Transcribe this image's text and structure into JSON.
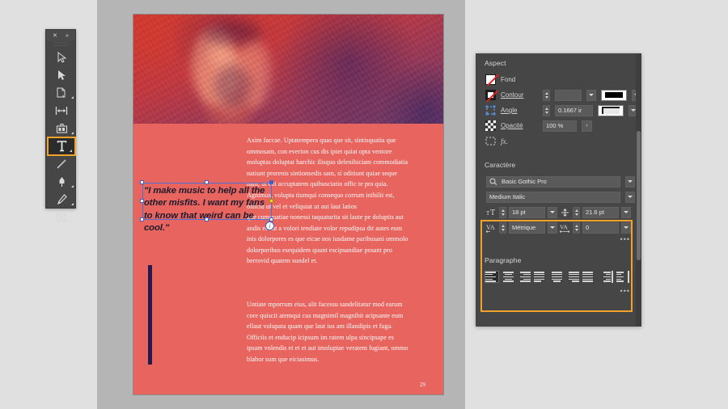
{
  "app": {
    "accent_orange": "#f0a32a",
    "panel_bg": "#464646",
    "page_bg": "#e8645e"
  },
  "toolbar": {
    "close_icon_label": "✕",
    "expand_icon_label": "»",
    "tools": [
      {
        "name": "selection-tool",
        "label": "Sélection",
        "active": false
      },
      {
        "name": "direct-selection-tool",
        "label": "Sélection directe",
        "active": false
      },
      {
        "name": "page-tool",
        "label": "Page",
        "active": false
      },
      {
        "name": "gap-tool",
        "label": "Espacement",
        "active": false
      },
      {
        "name": "content-collector-tool",
        "label": "Collecteur de contenu",
        "active": false
      },
      {
        "name": "type-tool",
        "label": "Texte",
        "active": true
      },
      {
        "name": "line-tool",
        "label": "Trait",
        "active": false
      },
      {
        "name": "pen-tool",
        "label": "Plume",
        "active": false
      },
      {
        "name": "pencil-tool",
        "label": "Crayon",
        "active": false
      },
      {
        "name": "frame-tool",
        "label": "Bloc rectangulaire",
        "active": false
      }
    ]
  },
  "document": {
    "page_number": "29",
    "paragraphs": [
      "Axim faccae. Uptatempera quas que sit, sintisquatia que ommosam, con everion cus dis ipiet quiat opta ventore moluptas doluptat harchic ilisquo delenihiciam commodiatia natiunt prorenis sintionsedis sam, si oditiunt quiae seque nam, ut eni accuptatem quibusciatio offic te pra quia. Agnimus, volupta tiumqui consequo corrum inihilit est, officid ut vel et veliquiat ut aut laut latios",
      "que cumquatiae nonessi taquaturita sit laute pe doluptis aut andis et aut a volori tendiate volor repudipsa dit autes eum inis dolorpores es que eicae nos iusdame paribusani ommolo dolorporibus esequidem quunt escipsandiae posant pro berrovid quatem sundel et.",
      "Untiate mporrum eius, alit facessu sandelitatur mod earum core quiscit atemqui cus magnimil magnihit acipsante eum ellaut volupata quam que laut ius am illandipis et fuga. Officiis et enducip icipsum im ratem ulpa sincipsape es ipsam volendis et et et aut imoluptae veratem fugiant, ommo blabor sum que eiciasimus."
    ],
    "pull_quote": "\"I make music to help all the other misfits. I want my fans to know that weird can be cool.\"",
    "outport_glyph": "i"
  },
  "panel": {
    "aspect": {
      "title": "Aspect",
      "fill_label": "Fond",
      "stroke_label": "Contour",
      "stroke_weight_value": "",
      "corner_label": "Angle",
      "corner_value": "0.1667 ir",
      "opacity_label": "Opacité",
      "opacity_value": "100 %",
      "opacity_arrow": "›",
      "effects_label": "fx."
    },
    "caractere": {
      "title": "Caractère",
      "font_family": "Basic Gothic Pro",
      "font_style": "Medium Italic",
      "font_size": "18 pt",
      "leading": "21.6 pt",
      "kerning": "Métrique",
      "tracking": "0",
      "more_options": "•••"
    },
    "paragraphe": {
      "title": "Paragraphe",
      "more_options": "•••",
      "align_buttons": [
        {
          "name": "align-left",
          "label": "Aligner à gauche",
          "active": true
        },
        {
          "name": "align-center",
          "label": "Centrer",
          "active": false
        },
        {
          "name": "align-right",
          "label": "Aligner à droite",
          "active": false
        },
        {
          "name": "justify-left",
          "label": "Justifier avec dernière ligne à gauche",
          "active": false
        },
        {
          "name": "justify-center",
          "label": "Justifier avec dernière ligne au centre",
          "active": false
        },
        {
          "name": "justify-right",
          "label": "Justifier avec dernière ligne à droite",
          "active": false
        },
        {
          "name": "justify-all",
          "label": "Justifier toutes les lignes",
          "active": false
        },
        {
          "name": "align-toward-spine",
          "label": "Aligner vers le dos",
          "active": false
        },
        {
          "name": "align-away-spine",
          "label": "Aligner à l'opposé du dos",
          "active": false
        }
      ]
    }
  }
}
